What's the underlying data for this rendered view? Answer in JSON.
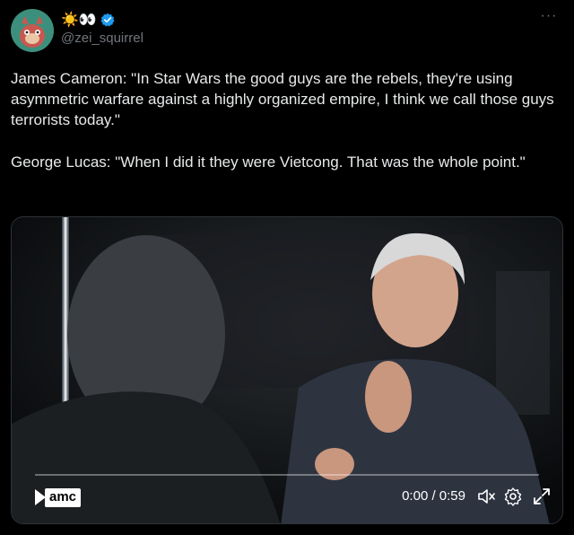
{
  "post": {
    "display_name": "☀️👀",
    "handle": "@zei_squirrel",
    "more_label": "···",
    "paragraphs": [
      "James Cameron: \"In Star Wars the good guys are the rebels, they're using asymmetric warfare against a highly organized empire, I think we call those guys terrorists today.\"",
      "George Lucas: \"When I did it they were Vietcong. That was the whole point.\""
    ]
  },
  "video": {
    "logo_text": "amc",
    "time": "0:00 / 0:59",
    "progress_fraction": 0
  },
  "colors": {
    "background": "#000000",
    "text": "#e7e9ea",
    "muted": "#71767b",
    "verified": "#1d9bf0",
    "avatar": "#3a8c7a"
  },
  "icons": [
    "verified-badge-icon",
    "more-icon",
    "volume-muted-icon",
    "settings-icon",
    "expand-icon",
    "play-icon"
  ]
}
